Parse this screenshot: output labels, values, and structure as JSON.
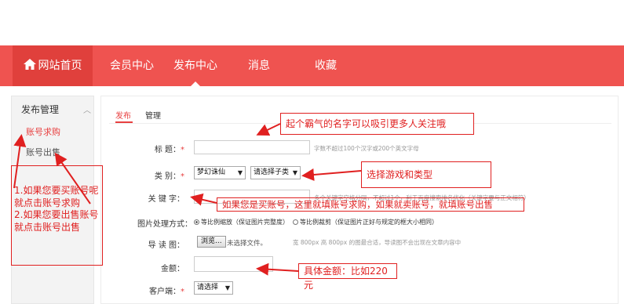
{
  "nav": {
    "home": "网站首页",
    "items": [
      "会员中心",
      "发布中心",
      "消息",
      "收藏"
    ]
  },
  "sidebar": {
    "title": "发布管理",
    "items": [
      "账号求购",
      "账号出售"
    ]
  },
  "tabs": [
    "发布",
    "管理"
  ],
  "form": {
    "title_label": "标 题：",
    "title_hint": "字数不超过100个汉字或200个英文字母",
    "category_label": "类 别：",
    "category_value": "梦幻诛仙",
    "subcategory_value": "请选择子类",
    "keyword_label": "关 键 字：",
    "keyword_hint": "多个关键字空格分隔，不超过1个，利于百度搜索排名优化（关键字要与正文相符）",
    "image_mode_label": "图片处理方式：",
    "image_mode_options": [
      "等比例缩放（保证图片完整度）",
      "等比例裁剪（保证图片正好与规定的框大小相同）"
    ],
    "guide_image_label": "导 读 图：",
    "browse_button": "浏览...",
    "no_file": "未选择文件。",
    "guide_hint": "宽 800px 高 800px 的图最合适，导读图不会出现在文章内容中",
    "amount_label": "金额：",
    "client_label": "客户端：",
    "client_value": "请选择"
  },
  "annotations": {
    "sidebar_note": "1.如果您要买账号呢就点击账号求购\n2.如果您要出售账号就点击账号出售",
    "title_note": "起个霸气的名字可以吸引更多人关注哦",
    "category_note": "选择游戏和类型",
    "keyword_note": "如果您是买账号，这里就填账号求购，如果就卖账号，就填账号出售",
    "amount_note": "具体金额：比如220元"
  },
  "colors": {
    "nav_bg": "#ef5350",
    "home_bg": "#e0403c",
    "annotation": "#e02020"
  }
}
